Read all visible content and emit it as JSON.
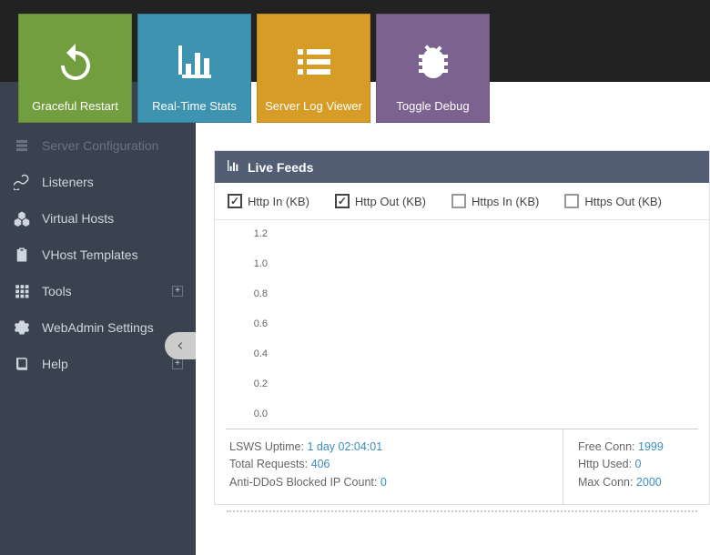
{
  "tiles": [
    {
      "label": "Graceful Restart"
    },
    {
      "label": "Real-Time Stats"
    },
    {
      "label": "Server Log Viewer"
    },
    {
      "label": "Toggle Debug"
    }
  ],
  "sidebar": {
    "items": [
      {
        "label": "Server Configuration",
        "expand": false
      },
      {
        "label": "Listeners",
        "expand": false
      },
      {
        "label": "Virtual Hosts",
        "expand": false
      },
      {
        "label": "VHost Templates",
        "expand": false
      },
      {
        "label": "Tools",
        "expand": true
      },
      {
        "label": "WebAdmin Settings",
        "expand": false
      },
      {
        "label": "Help",
        "expand": true
      }
    ]
  },
  "panel": {
    "title": "Live Feeds",
    "filters": [
      {
        "label": "Http In (KB)",
        "checked": true
      },
      {
        "label": "Http Out (KB)",
        "checked": true
      },
      {
        "label": "Https In (KB)",
        "checked": false
      },
      {
        "label": "Https Out (KB)",
        "checked": false
      }
    ]
  },
  "chart_data": {
    "type": "line",
    "title": "Live Feeds",
    "xlabel": "",
    "ylabel": "",
    "ylim": [
      0.0,
      1.2
    ],
    "y_ticks": [
      "1.2",
      "1.0",
      "0.8",
      "0.6",
      "0.4",
      "0.2",
      "0.0"
    ],
    "series": [
      {
        "name": "Http In (KB)",
        "values": []
      },
      {
        "name": "Http Out (KB)",
        "values": []
      },
      {
        "name": "Https In (KB)",
        "values": []
      },
      {
        "name": "Https Out (KB)",
        "values": []
      }
    ]
  },
  "stats": {
    "left": [
      {
        "label": "LSWS Uptime: ",
        "value": "1 day 02:04:01"
      },
      {
        "label": "Total Requests: ",
        "value": "406"
      },
      {
        "label": "Anti-DDoS Blocked IP Count: ",
        "value": "0"
      }
    ],
    "right": [
      {
        "label": "Free Conn: ",
        "value": "1999"
      },
      {
        "label": "Http Used: ",
        "value": "0"
      },
      {
        "label": "Max Conn: ",
        "value": "2000"
      }
    ]
  }
}
